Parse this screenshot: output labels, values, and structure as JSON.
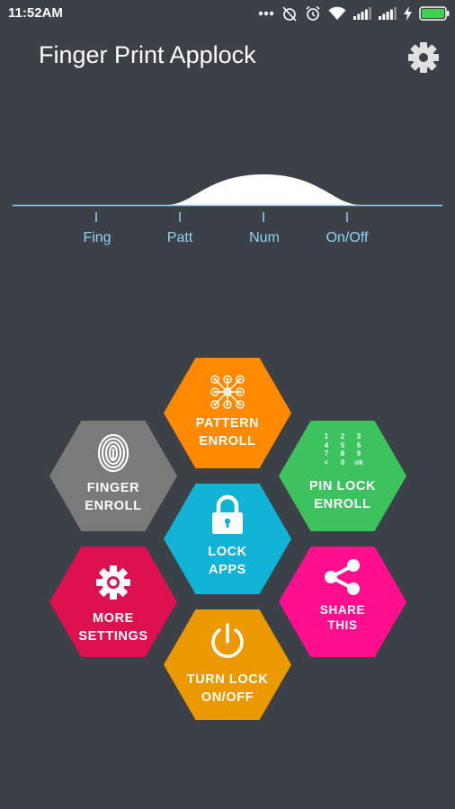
{
  "status_bar": {
    "time": "11:52AM",
    "icons": [
      "more-dots-icon",
      "alarm-off-icon",
      "alarm-icon",
      "wifi-icon",
      "signal-icon",
      "signal-icon",
      "charging-bolt-icon",
      "battery-icon"
    ]
  },
  "header": {
    "title": "Finger Print Applock",
    "settings_icon": "gear-icon"
  },
  "mode_slider": {
    "labels": [
      "Fing",
      "Patt",
      "Num",
      "On/Off"
    ],
    "selected": "Num",
    "color": "#8fd3f2"
  },
  "tiles": [
    {
      "id": "pattern-enroll",
      "line1": "PATTERN",
      "line2": "ENROLL",
      "color": "#ff8a00",
      "icon": "pattern-grid-icon"
    },
    {
      "id": "finger-enroll",
      "line1": "FINGER",
      "line2": "ENROLL",
      "color": "#7a7a7a",
      "icon": "fingerprint-icon"
    },
    {
      "id": "pin-lock-enroll",
      "line1": "PIN LOCK",
      "line2": "ENROLL",
      "color": "#3cc35e",
      "icon": "keypad-icon",
      "keypad": [
        "1",
        "2",
        "3",
        "4",
        "5",
        "6",
        "7",
        "8",
        "9",
        "<",
        "0",
        "ok"
      ]
    },
    {
      "id": "lock-apps",
      "line1": "LOCK",
      "line2": "APPS",
      "color": "#11b3d6",
      "icon": "padlock-icon"
    },
    {
      "id": "more-settings",
      "line1": "MORE",
      "line2": "SETTINGS",
      "color": "#de1150",
      "icon": "gear-icon"
    },
    {
      "id": "share-this",
      "line1": "SHARE",
      "line2": "THIS",
      "color": "#ff0f8e",
      "icon": "share-icon"
    },
    {
      "id": "turn-lock-onoff",
      "line1": "TURN LOCK",
      "line2": "ON/OFF",
      "color": "#ec9800",
      "icon": "power-icon"
    }
  ]
}
